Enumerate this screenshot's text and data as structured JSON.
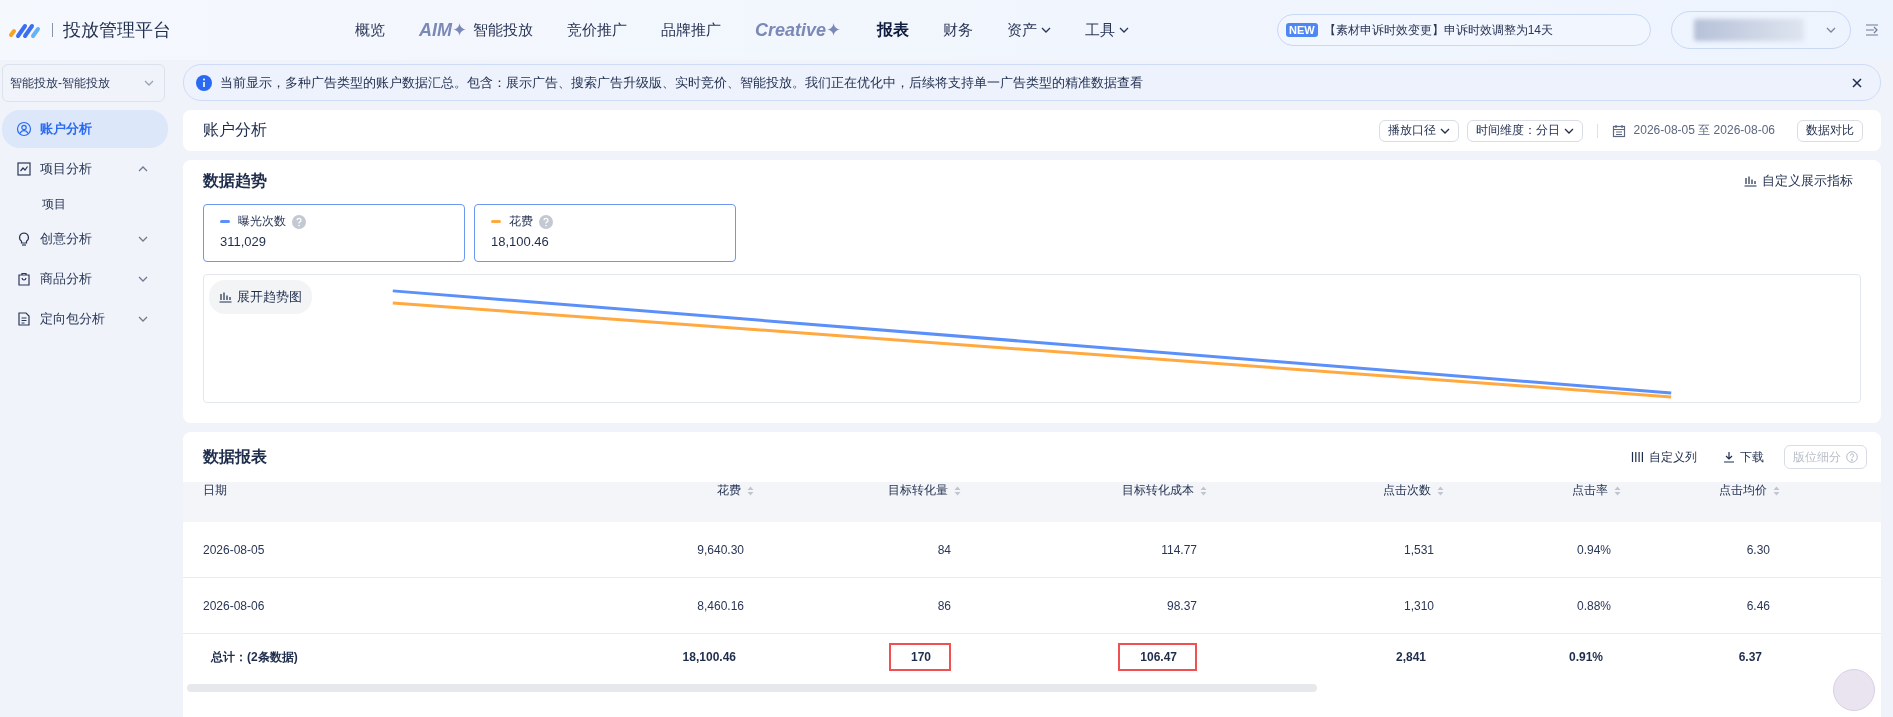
{
  "brand": {
    "title": "投放管理平台"
  },
  "nav": [
    {
      "kind": "plain",
      "label": "概览",
      "selected": false
    },
    {
      "kind": "branded",
      "logo": "AIM✦",
      "label": "智能投放",
      "selected": false
    },
    {
      "kind": "plain",
      "label": "竞价推广",
      "selected": false
    },
    {
      "kind": "plain",
      "label": "品牌推广",
      "selected": false
    },
    {
      "kind": "branded",
      "logo": "Creative✦",
      "selected": false
    },
    {
      "kind": "plain",
      "label": "报表",
      "selected": true
    },
    {
      "kind": "plain",
      "label": "财务",
      "selected": false
    },
    {
      "kind": "dropdown",
      "label": "资产",
      "selected": false
    },
    {
      "kind": "dropdown",
      "label": "工具",
      "selected": false
    }
  ],
  "notice": {
    "badge": "NEW",
    "text": "【素材申诉时效变更】申诉时效调整为14天"
  },
  "sidebar": {
    "account_select": "智能投放-智能投放",
    "items": [
      {
        "label": "账户分析",
        "selected": true
      },
      {
        "label": "项目分析",
        "selected": false,
        "expanded": true,
        "children": [
          {
            "label": "项目",
            "selected": false
          }
        ]
      },
      {
        "label": "创意分析",
        "selected": false,
        "expanded": false
      },
      {
        "label": "商品分析",
        "selected": false,
        "expanded": false
      },
      {
        "label": "定向包分析",
        "selected": false,
        "expanded": false
      }
    ]
  },
  "banner": {
    "text": "当前显示，多种广告类型的账户数据汇总。包含：展示广告、搜索广告升级版、实时竞价、智能投放。我们正在优化中，后续将支持单一广告类型的精准数据查看"
  },
  "header": {
    "title": "账户分析",
    "filters": [
      "播放口径",
      "时间维度：分日"
    ],
    "date_range": "2026-08-05 至 2026-08-06",
    "compare_button": "数据对比"
  },
  "trend": {
    "title": "数据趋势",
    "custom_button": "自定义展示指标",
    "expand_button": "展开趋势图",
    "metrics": [
      {
        "name": "曝光次数",
        "value": "311,029",
        "color": "#5b8ff9",
        "selected": true
      },
      {
        "name": "花费",
        "value": "18,100.46",
        "color": "#ffa940",
        "selected": true
      }
    ]
  },
  "report": {
    "title": "数据报表",
    "tools": [
      {
        "kind": "columns",
        "label": "自定义列",
        "disabled": false
      },
      {
        "kind": "download",
        "label": "下载",
        "disabled": false
      },
      {
        "kind": "breakdown",
        "label": "版位细分",
        "disabled": true
      }
    ],
    "columns": [
      "日期",
      "花费",
      "目标转化量",
      "目标转化成本",
      "点击次数",
      "点击率",
      "点击均价"
    ],
    "rows": [
      [
        "2026-08-05",
        "9,640.30",
        "84",
        "114.77",
        "1,531",
        "0.94%",
        "6.30"
      ],
      [
        "2026-08-06",
        "8,460.16",
        "86",
        "98.37",
        "1,310",
        "0.88%",
        "6.46"
      ]
    ],
    "total": [
      {
        "text": "总计：(2条数据)",
        "highlighted": false
      },
      {
        "text": "18,100.46",
        "highlighted": false
      },
      {
        "text": "170",
        "highlighted": true
      },
      {
        "text": "106.47",
        "highlighted": true
      },
      {
        "text": "2,841",
        "highlighted": false
      },
      {
        "text": "0.91%",
        "highlighted": false
      },
      {
        "text": "6.37",
        "highlighted": false
      }
    ]
  }
}
